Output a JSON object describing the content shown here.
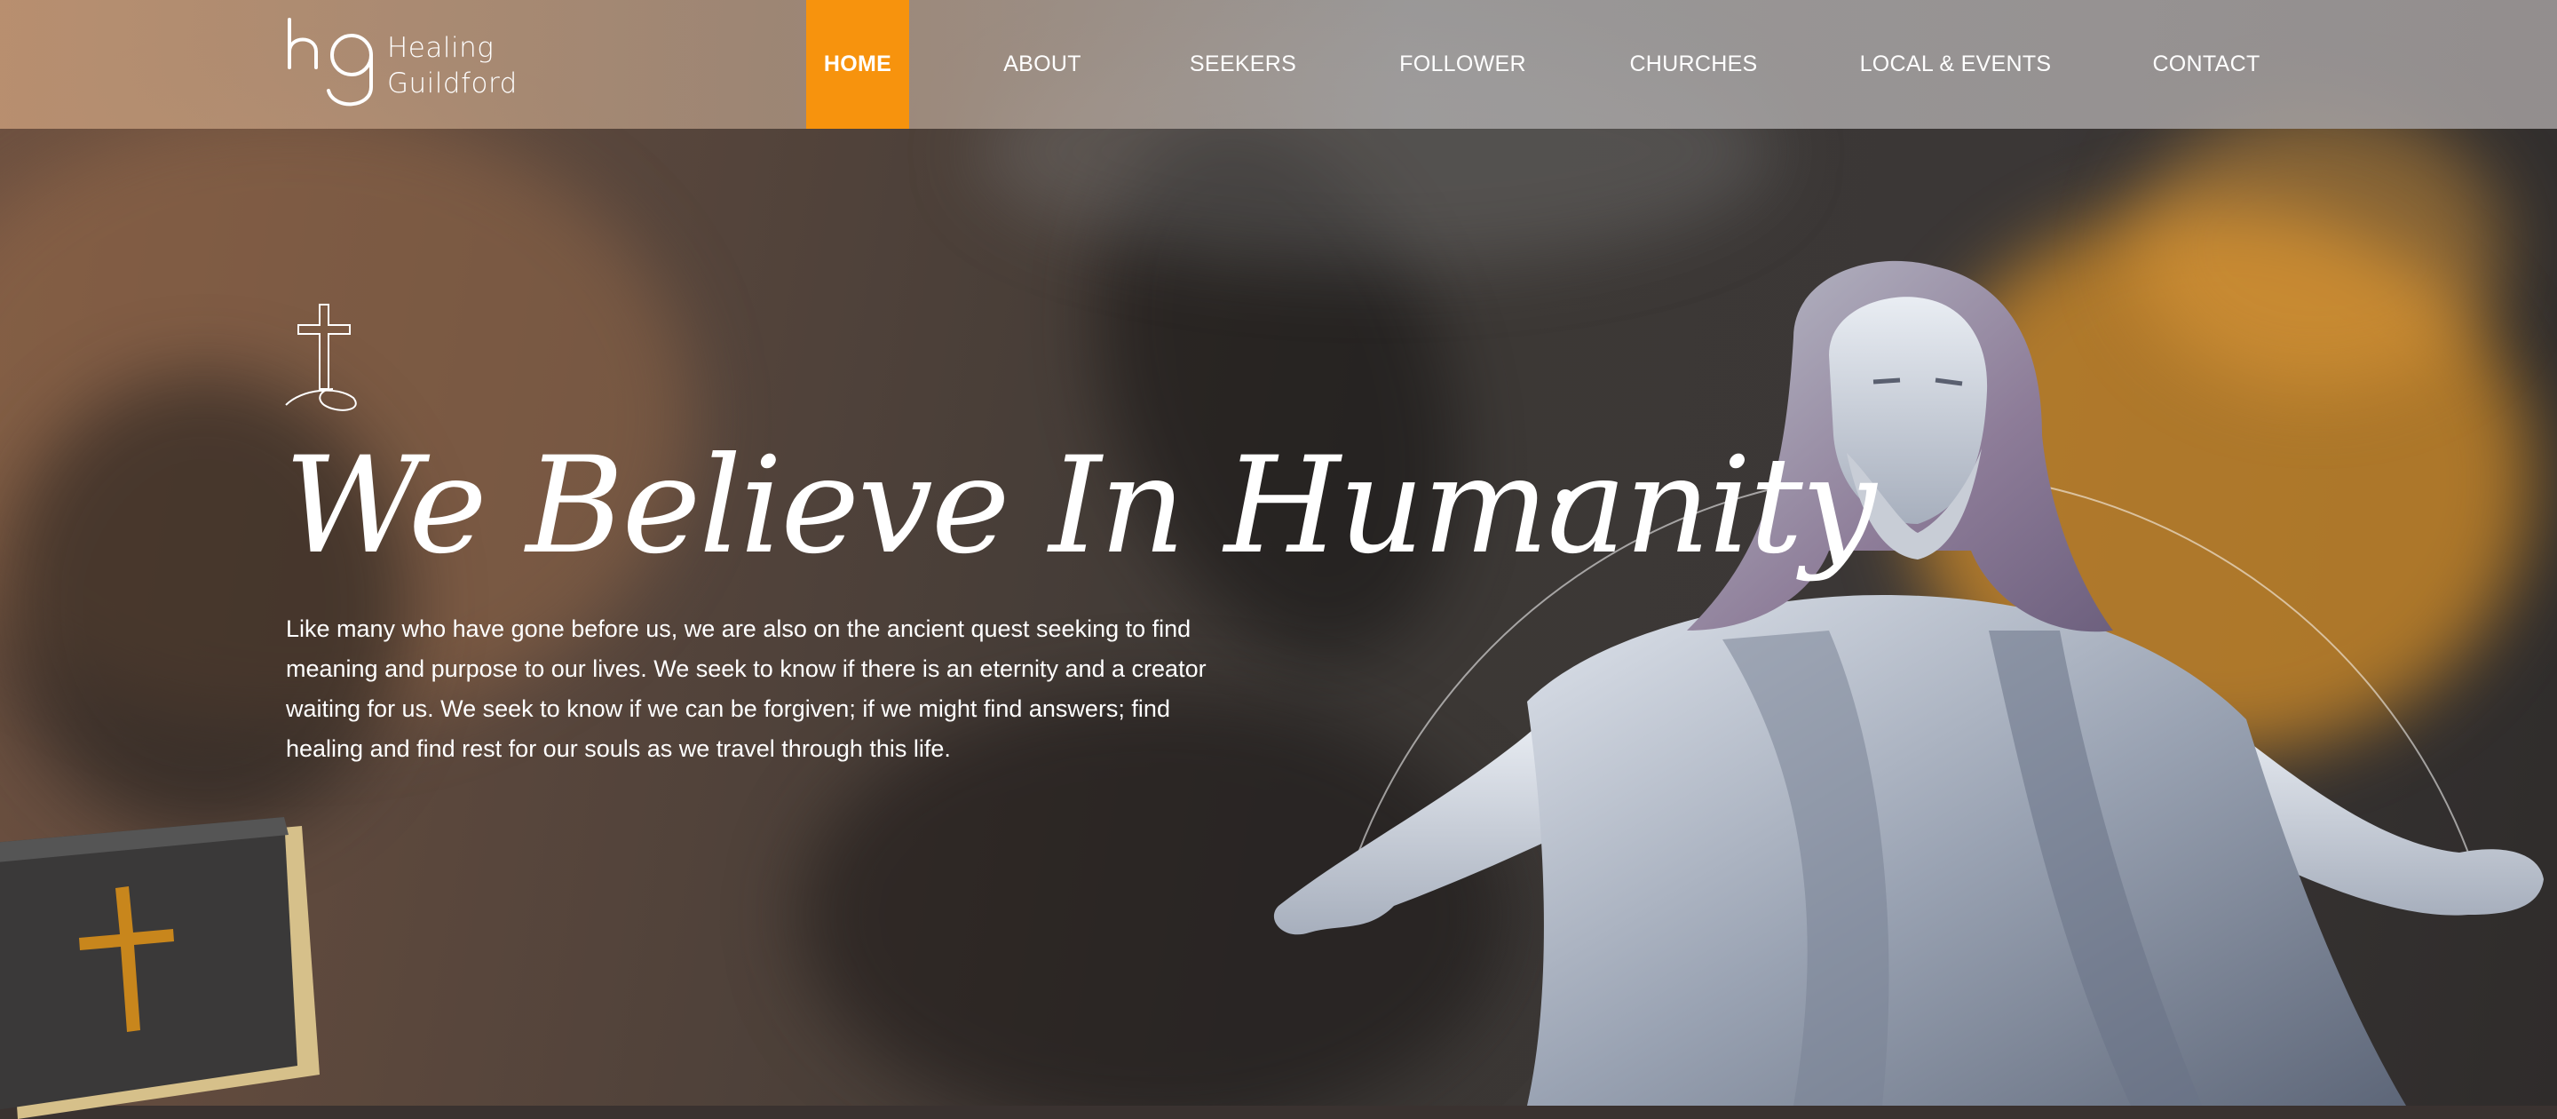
{
  "brand": {
    "logo_line1": "Healing",
    "logo_line2": "Guildford"
  },
  "nav": {
    "items": [
      {
        "label": "HOME",
        "active": true
      },
      {
        "label": "ABOUT"
      },
      {
        "label": "SEEKERS"
      },
      {
        "label": "FOLLOWER"
      },
      {
        "label": "CHURCHES"
      },
      {
        "label": "LOCAL & EVENTS"
      },
      {
        "label": "CONTACT"
      }
    ]
  },
  "hero": {
    "title": "We Believe In Humanity",
    "paragraph_lines": [
      "Like many who have gone before us, we are also on the ancient quest seeking to find",
      "meaning and purpose to our lives. We seek to know if there is an eternity and a creator",
      "waiting for us. We seek to know if we can be forgiven; if we might find answers; find",
      "healing and find rest for our souls as we travel through this life."
    ]
  },
  "icons": [
    "hg-logo-icon",
    "cross-on-hill-icon",
    "bible-icon",
    "statue-image"
  ],
  "colors": {
    "accent": "#f7930d",
    "text": "#ffffff"
  }
}
